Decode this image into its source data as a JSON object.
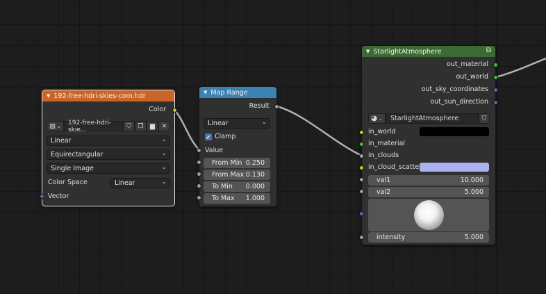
{
  "image_node": {
    "title": "192-free-hdri-skies-com.hdr",
    "header_color": "#c96528",
    "output_color_label": "Color",
    "image_name": "192-free-hdri-skie...",
    "interpolation": "Linear",
    "projection": "Equirectangular",
    "source": "Single Image",
    "color_space_label": "Color Space",
    "color_space": "Linear",
    "vector_label": "Vector"
  },
  "map_range_node": {
    "title": "Map Range",
    "header_color": "#3b82b5",
    "result_label": "Result",
    "interpolation": "Linear",
    "clamp_label": "Clamp",
    "clamp_checked": true,
    "value_label": "Value",
    "fields": [
      {
        "label": "From Min",
        "value": "0.250"
      },
      {
        "label": "From Max",
        "value": "0.130"
      },
      {
        "label": "To Min",
        "value": "0.000"
      },
      {
        "label": "To Max",
        "value": "1.000"
      }
    ]
  },
  "group_node": {
    "title": "StarlightAtmosphere",
    "header_color": "#3b6b33",
    "outputs": [
      {
        "label": "out_material",
        "socket": "green"
      },
      {
        "label": "out_world",
        "socket": "green"
      },
      {
        "label": "out_sky_coordinates",
        "socket": "blue"
      },
      {
        "label": "out_sun_direction",
        "socket": "blue"
      }
    ],
    "group_name": "StarlightAtmosphere",
    "inputs": [
      {
        "label": "in_world",
        "socket": "yellow",
        "swatch": "#000000"
      },
      {
        "label": "in_material",
        "socket": "green"
      },
      {
        "label": "in_clouds",
        "socket": "gray"
      },
      {
        "label": "in_cloud_scatter",
        "socket": "yellow",
        "swatch": "#a9b1ee"
      }
    ],
    "values": [
      {
        "label": "val1",
        "value": "10.000"
      },
      {
        "label": "val2",
        "value": "5.000"
      }
    ],
    "intensity_label": "intensity",
    "intensity_value": "5.000"
  }
}
